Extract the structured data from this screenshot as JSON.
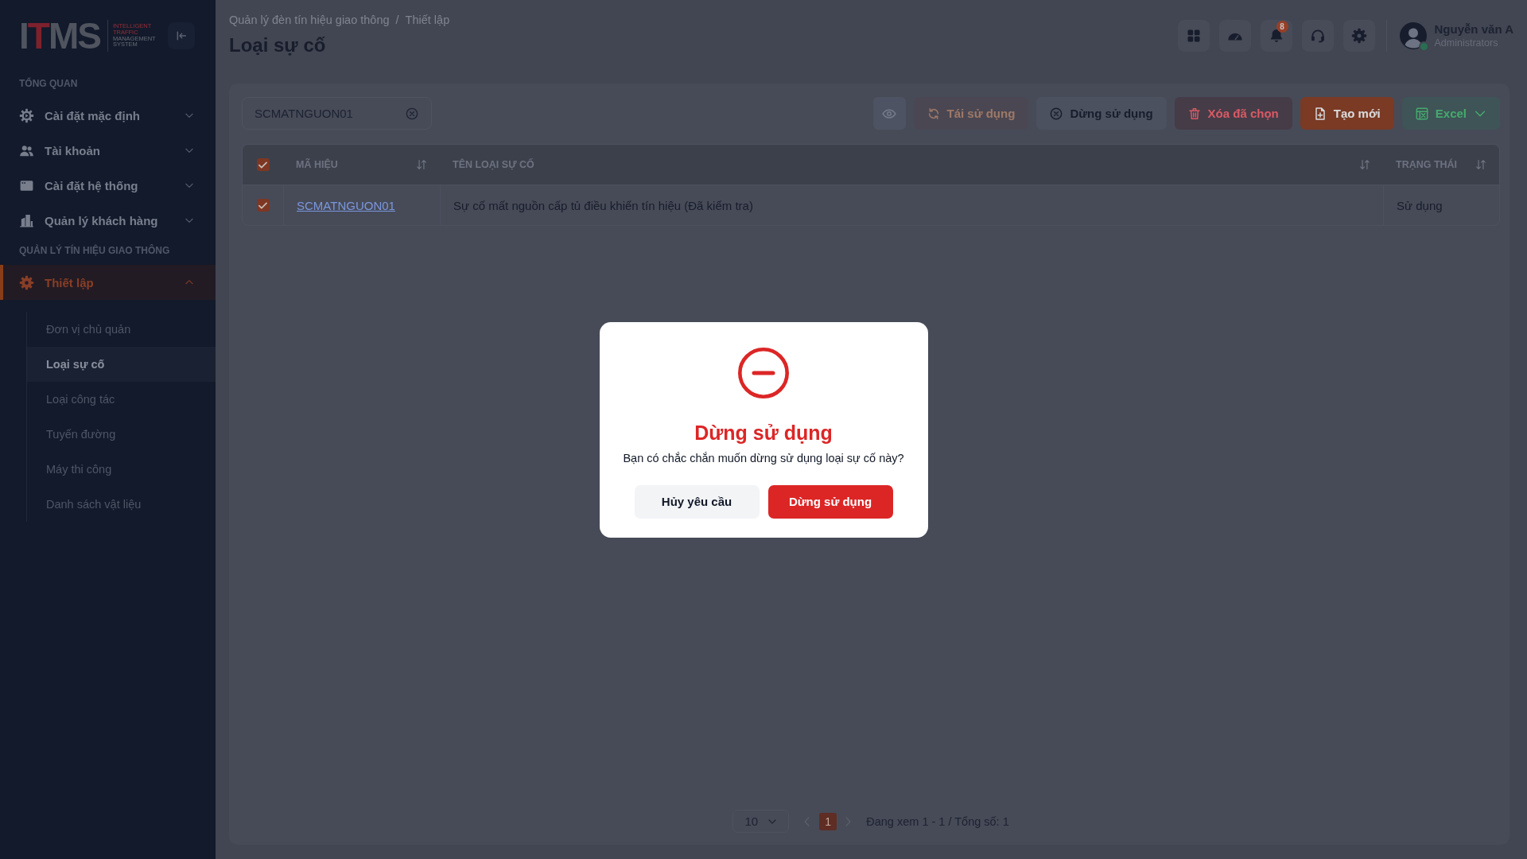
{
  "sidebar": {
    "logo": {
      "mark": [
        {
          "text": "I",
          "accent": false
        },
        {
          "text": "T",
          "accent": true
        },
        {
          "text": "MS",
          "accent": false
        }
      ],
      "tagline": [
        {
          "text": "INTELLIGENT",
          "accent": true
        },
        {
          "text": "TRAFFIC",
          "accent": true
        },
        {
          "text": "MANAGEMENT",
          "accent": false
        },
        {
          "text": "SYSTEM",
          "accent": false
        }
      ]
    },
    "sections": [
      {
        "title": "TỔNG QUAN",
        "items": [
          {
            "label": "Cài đặt mặc định",
            "expanded": false,
            "selected": false
          },
          {
            "label": "Tài khoản",
            "expanded": false,
            "selected": false
          },
          {
            "label": "Cài đặt hệ thống",
            "expanded": false,
            "selected": false
          },
          {
            "label": "Quản lý khách hàng",
            "expanded": false,
            "selected": false
          }
        ]
      },
      {
        "title": "QUẢN LÝ TÍN HIỆU GIAO THÔNG",
        "items": [
          {
            "label": "Thiết lập",
            "expanded": true,
            "selected": true,
            "children": [
              {
                "label": "Đơn vị chủ quản",
                "selected": false
              },
              {
                "label": "Loại sự cố",
                "selected": true
              },
              {
                "label": "Loại công tác",
                "selected": false
              },
              {
                "label": "Tuyến đường",
                "selected": false
              },
              {
                "label": "Máy thi công",
                "selected": false
              },
              {
                "label": "Danh sách vật liệu",
                "selected": false
              }
            ]
          }
        ]
      }
    ]
  },
  "header": {
    "breadcrumb": [
      "Quản lý đèn tín hiệu giao thông",
      "Thiết lập"
    ],
    "breadcrumb_separator": "/",
    "title": "Loại sự cố",
    "notification_badge": "8",
    "user": {
      "name": "Nguyễn văn A",
      "role": "Administrators",
      "online": true
    }
  },
  "toolbar": {
    "search": {
      "value": "SCMATNGUON01"
    },
    "buttons": [
      {
        "kind": "view",
        "disabled": false
      },
      {
        "kind": "reuse",
        "label": "Tái sử dụng",
        "disabled": true
      },
      {
        "kind": "stop",
        "label": "Dừng sử dụng",
        "disabled": false
      },
      {
        "kind": "delete",
        "label": "Xóa đã chọn",
        "disabled": false
      },
      {
        "kind": "create",
        "label": "Tạo mới",
        "disabled": false
      },
      {
        "kind": "excel",
        "label": "Excel",
        "disabled": false
      }
    ]
  },
  "table": {
    "all_checked": true,
    "columns": [
      {
        "label": "MÃ HIỆU",
        "sortable": true
      },
      {
        "label": "TÊN LOẠI SỰ CỐ",
        "sortable": true
      },
      {
        "label": "TRẠNG THÁI",
        "sortable": true
      }
    ],
    "rows": [
      {
        "checked": true,
        "code": "SCMATNGUON01",
        "name": "Sự cố mất nguồn cấp tủ điều khiển tín hiệu (Đã kiểm tra)",
        "status": "Sử dụng"
      }
    ]
  },
  "pagination": {
    "page_size": "10",
    "pages": [
      {
        "label": "1",
        "selected": true
      }
    ],
    "summary": "Đang xem 1 - 1 / Tổng số: 1"
  },
  "dialog": {
    "title": "Dừng sử dụng",
    "message": "Bạn có chắc chắn muốn dừng sử dụng loại sự cố này?",
    "buttons": [
      {
        "kind": "cancel",
        "label": "Hủy yêu cầu"
      },
      {
        "kind": "confirm",
        "label": "Dừng sử dụng"
      }
    ]
  }
}
